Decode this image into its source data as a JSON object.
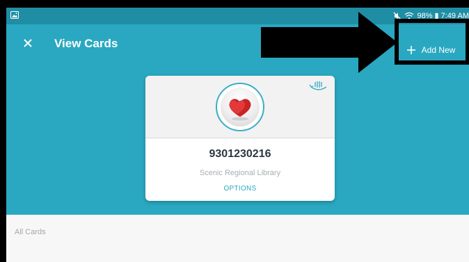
{
  "status_bar": {
    "text": "98% ▮ 7:49 AM",
    "icons": [
      "gallery-icon",
      "mute-icon",
      "wifi-icon",
      "battery-icon"
    ]
  },
  "toolbar": {
    "close_icon": "close-icon",
    "title": "View Cards",
    "add_new_label": "Add New",
    "add_icon": "plus-icon"
  },
  "card": {
    "number": "9301230216",
    "library": "Scenic Regional Library",
    "options_label": "OPTIONS",
    "logo_icon": "hearts-logo-icon",
    "flip_icon": "flip-card-icon"
  },
  "section": {
    "all_cards_label": "All Cards"
  },
  "colors": {
    "primary": "#2aa8c1",
    "status_bar": "#1f8ea5",
    "panel": "#f7f7f7",
    "annotation": "#000000",
    "heart": "#d42a2a"
  }
}
